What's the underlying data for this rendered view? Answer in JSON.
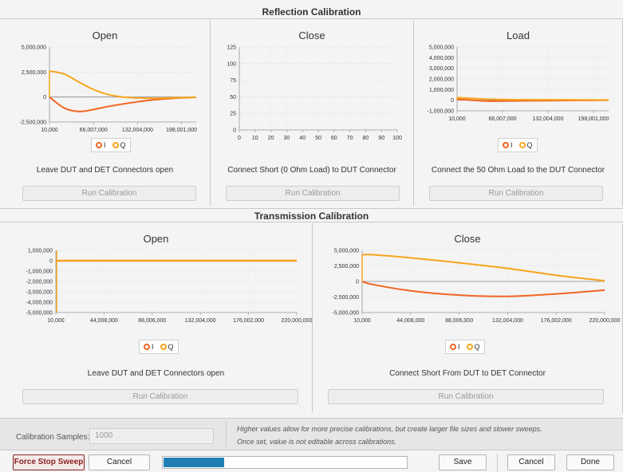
{
  "reflection": {
    "header": "Reflection Calibration",
    "panels": [
      {
        "title": "Open",
        "instruction": "Leave DUT and DET Connectors open",
        "run_label": "Run Calibration",
        "chart": {
          "yticks": [
            "5,000,000",
            "2,500,000",
            "0",
            "-2,500,000"
          ],
          "xticks": [
            "10,000",
            "66,007,000",
            "132,004,000",
            "198,001,000"
          ],
          "legend": [
            "I",
            "Q"
          ]
        }
      },
      {
        "title": "Close",
        "instruction": "Connect Short (0 Ohm Load) to DUT Connector",
        "run_label": "Run Calibration",
        "chart": {
          "yticks": [
            "125",
            "100",
            "75",
            "50",
            "25",
            "0"
          ],
          "xticks": [
            "0",
            "10",
            "20",
            "30",
            "40",
            "50",
            "60",
            "70",
            "80",
            "90",
            "100"
          ],
          "legend": []
        }
      },
      {
        "title": "Load",
        "instruction": "Connect the 50 Ohm Load to the DUT Connector",
        "run_label": "Run Calibration",
        "chart": {
          "yticks": [
            "5,000,000",
            "4,000,000",
            "3,000,000",
            "2,000,000",
            "1,000,000",
            "0",
            "-1,000,000"
          ],
          "xticks": [
            "10,000",
            "66,007,000",
            "132,004,000",
            "198,001,000"
          ],
          "legend": [
            "I",
            "Q"
          ]
        }
      }
    ]
  },
  "transmission": {
    "header": "Transmission Calibration",
    "panels": [
      {
        "title": "Open",
        "instruction": "Leave DUT and DET Connectors open",
        "run_label": "Run Calibration",
        "chart": {
          "yticks": [
            "1,000,000",
            "0",
            "-1,000,000",
            "-2,000,000",
            "-3,000,000",
            "-4,000,000",
            "-5,000,000"
          ],
          "xticks": [
            "10,000",
            "44,008,000",
            "88,006,000",
            "132,004,000",
            "176,002,000",
            "220,000,000"
          ],
          "legend": [
            "I",
            "Q"
          ]
        }
      },
      {
        "title": "Close",
        "instruction": "Connect Short From DUT to DET Connector",
        "run_label": "Run Calibration",
        "chart": {
          "yticks": [
            "5,000,000",
            "2,500,000",
            "0",
            "-2,500,000",
            "-5,000,000"
          ],
          "xticks": [
            "10,000",
            "44,008,000",
            "88,006,000",
            "132,004,000",
            "176,002,000",
            "220,000,000"
          ],
          "legend": [
            "I",
            "Q"
          ]
        }
      }
    ]
  },
  "colors": {
    "I": "#f26522",
    "Q": "#f7a51c",
    "zero_line": "#888888",
    "accent": "#8a1f1f",
    "progress": "#1f7fb3"
  },
  "samples": {
    "label": "Calibration Samples:",
    "value": "1000",
    "note_line1": "Higher values allow for more precise calibrations, but create larger file sizes and slower sweeps.",
    "note_line2": "Once set, value is not editable across calibrations."
  },
  "toolbar": {
    "force_stop": "Force Stop Sweep",
    "cancel_left": "Cancel",
    "progress_fraction": 0.25,
    "save": "Save",
    "cancel_right": "Cancel",
    "done": "Done"
  },
  "chart_data": [
    {
      "type": "line",
      "name": "Reflection Open",
      "x": [
        10000,
        22000000,
        44000000,
        66000000,
        88000000,
        110000000,
        132000000,
        154000000,
        176000000,
        198000000,
        220000000
      ],
      "series": [
        {
          "name": "I",
          "values": [
            0,
            -1100000,
            -1450000,
            -1250000,
            -950000,
            -700000,
            -480000,
            -300000,
            -180000,
            -90000,
            -30000
          ]
        },
        {
          "name": "Q",
          "values": [
            2600000,
            2300000,
            1500000,
            750000,
            250000,
            0,
            -100000,
            -130000,
            -100000,
            -60000,
            -20000
          ]
        }
      ],
      "ylim": [
        -2500000,
        5000000
      ],
      "xlim": [
        10000,
        220000000
      ]
    },
    {
      "type": "line",
      "name": "Reflection Close",
      "x": [],
      "series": [],
      "ylim": [
        0,
        125
      ],
      "xlim": [
        0,
        100
      ]
    },
    {
      "type": "line",
      "name": "Reflection Load",
      "x": [
        10000,
        44000000,
        88000000,
        132000000,
        176000000,
        220000000
      ],
      "series": [
        {
          "name": "I",
          "values": [
            100000,
            -80000,
            -60000,
            -40000,
            -20000,
            0
          ]
        },
        {
          "name": "Q",
          "values": [
            250000,
            100000,
            50000,
            40000,
            30000,
            20000
          ]
        }
      ],
      "ylim": [
        -1000000,
        5000000
      ],
      "xlim": [
        10000,
        220000000
      ]
    },
    {
      "type": "line",
      "name": "Transmission Open",
      "x": [
        10000,
        220000000
      ],
      "series": [
        {
          "name": "I",
          "values": [
            0,
            0
          ]
        },
        {
          "name": "Q",
          "values": [
            0,
            0
          ]
        }
      ],
      "ylim": [
        -5000000,
        1000000
      ],
      "xlim": [
        10000,
        220000000
      ]
    },
    {
      "type": "line",
      "name": "Transmission Close",
      "x": [
        10000,
        10000000,
        44000000,
        88000000,
        132000000,
        176000000,
        220000000
      ],
      "series": [
        {
          "name": "I",
          "values": [
            0,
            -500000,
            -1500000,
            -2200000,
            -2400000,
            -2000000,
            -1400000
          ]
        },
        {
          "name": "Q",
          "values": [
            4300000,
            4300000,
            3800000,
            3000000,
            2100000,
            1000000,
            100000
          ]
        }
      ],
      "ylim": [
        -5000000,
        5000000
      ],
      "xlim": [
        10000,
        220000000
      ]
    }
  ]
}
